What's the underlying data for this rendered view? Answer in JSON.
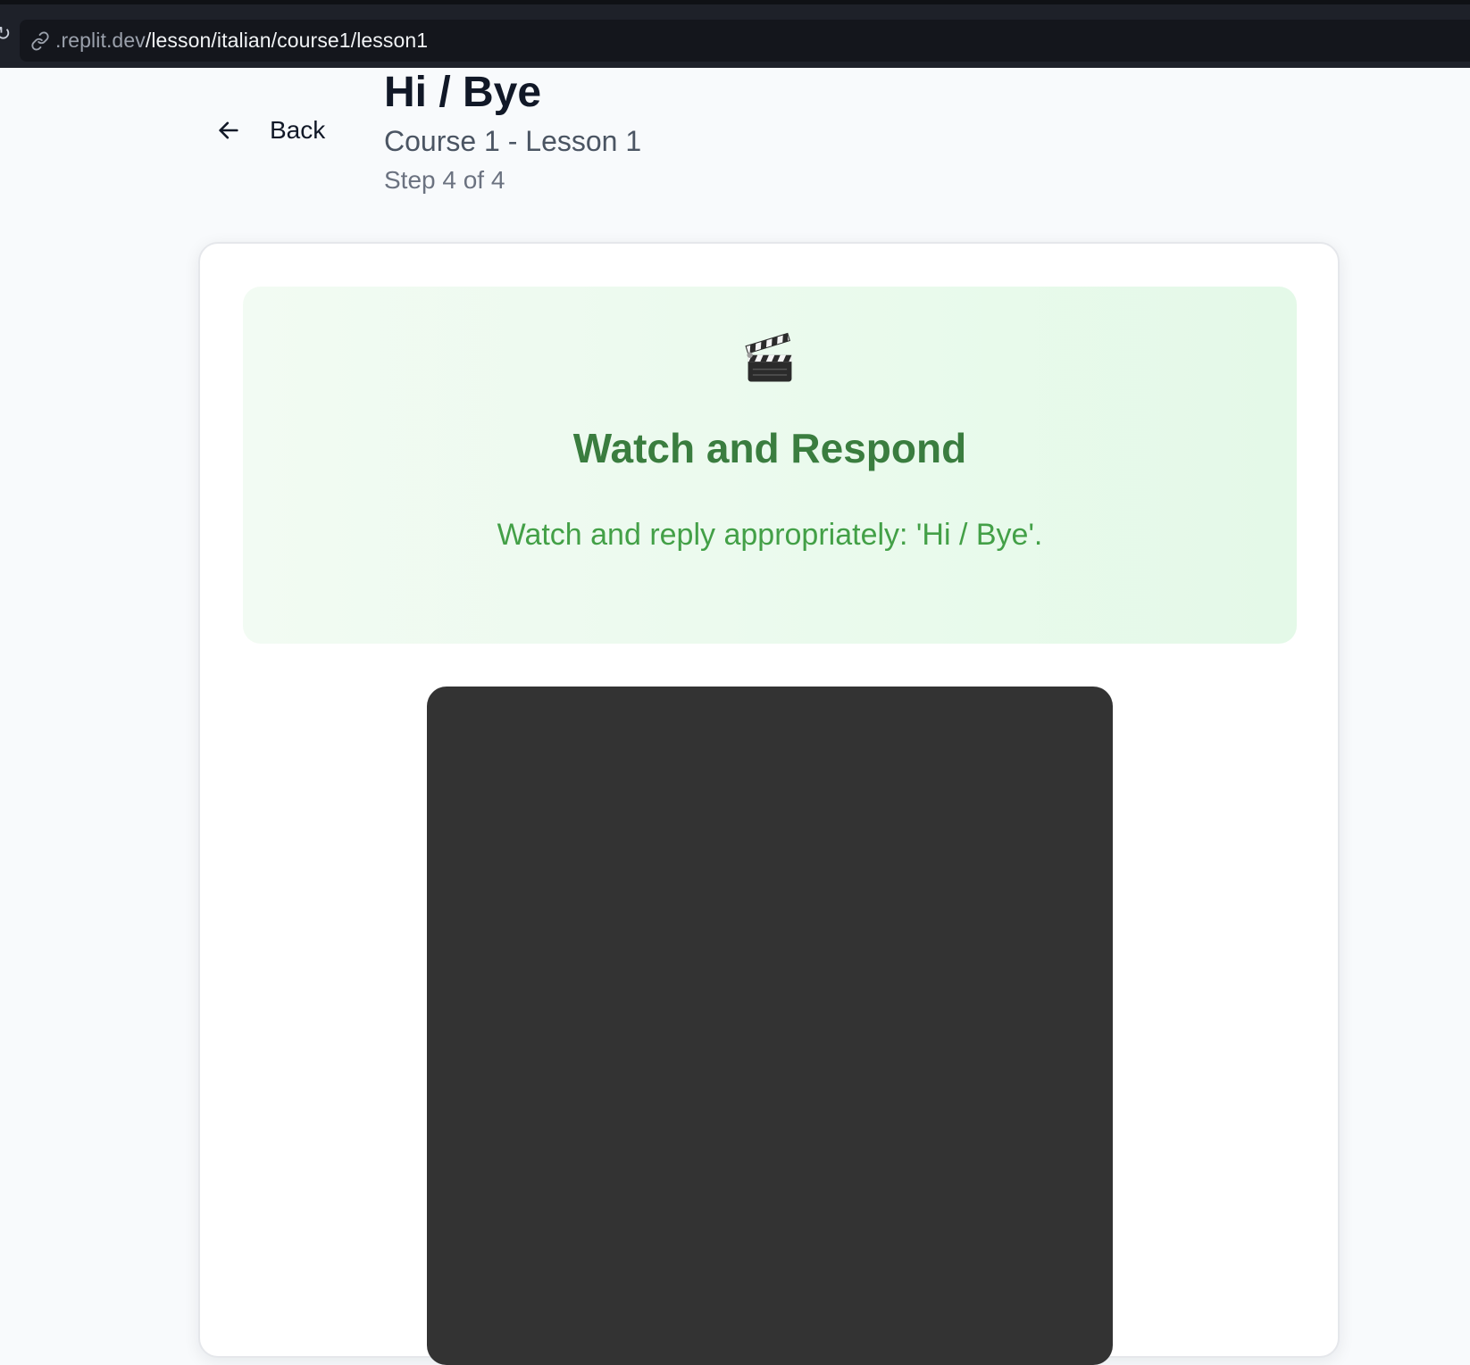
{
  "browser": {
    "url_host": ".replit.dev",
    "url_path": "/lesson/italian/course1/lesson1"
  },
  "header": {
    "back_label": "Back",
    "title": "Hi / Bye",
    "subtitle": "Course 1 - Lesson 1",
    "step": "Step 4 of 4"
  },
  "prompt": {
    "icon": "clapperboard-icon",
    "heading": "Watch and Respond",
    "instruction": "Watch and reply appropriately: 'Hi / Bye'."
  },
  "colors": {
    "page_background": "#f8fafc",
    "browser_bar": "#1e2129",
    "prompt_heading": "#3a7d3f",
    "prompt_text": "#43a047",
    "video_background": "#333333"
  }
}
